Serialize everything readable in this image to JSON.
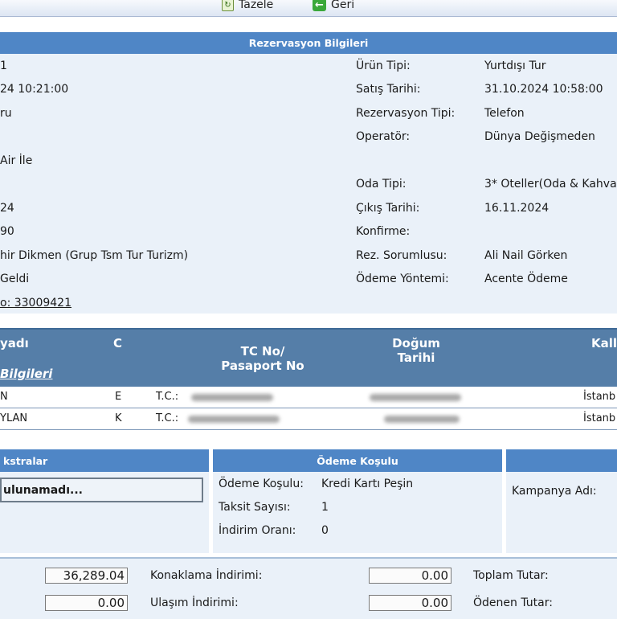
{
  "toolbar": {
    "refresh_label": "Tazele",
    "back_label": "Geri"
  },
  "reservation": {
    "title": "Rezervasyon Bilgileri",
    "left_values": [
      "1",
      "24 10:21:00",
      "ru",
      "",
      " Air İle",
      "",
      "24",
      "90",
      "hir Dikmen (Grup Tsm Tur Turizm)",
      " Geldi",
      "o: 33009421"
    ],
    "fields": [
      {
        "label": "Ürün Tipi:",
        "value": "Yurtdışı Tur"
      },
      {
        "label": "Satış Tarihi:",
        "value": "31.10.2024 10:58:00"
      },
      {
        "label": "Rezervasyon Tipi:",
        "value": "Telefon"
      },
      {
        "label": "Operatör:",
        "value": "Dünya Değişmeden"
      },
      {
        "label": "",
        "value": ""
      },
      {
        "label": "Oda Tipi:",
        "value": "3* Oteller(Oda & Kahva"
      },
      {
        "label": "Çıkış Tarihi:",
        "value": "16.11.2024"
      },
      {
        "label": "Konfirme:",
        "value": ""
      },
      {
        "label": "Rez. Sorumlusu:",
        "value": "Ali Nail Görken"
      },
      {
        "label": "Ödeme Yöntemi:",
        "value": "Acente Ödeme"
      }
    ]
  },
  "passengers": {
    "headers": {
      "surname": "yadı",
      "gender": "C",
      "tc_line1": "TC No/",
      "tc_line2": "Pasaport No",
      "birth_line1": "Doğum",
      "birth_line2": "Tarihi",
      "city": "Kall",
      "info_link": "Bilgileri"
    },
    "rows": [
      {
        "surname": "N",
        "gender": "E",
        "id_type": "T.C.:",
        "city": "İstanb"
      },
      {
        "surname": "YLAN",
        "gender": "K",
        "id_type": "T.C.:",
        "city": "İstanb"
      }
    ]
  },
  "extras": {
    "title": "kstralar",
    "box_text": "ulunamadı..."
  },
  "payment": {
    "title": "Ödeme Koşulu",
    "rows": [
      {
        "label": "Ödeme Koşulu:",
        "value": "Kredi Kartı Peşin"
      },
      {
        "label": "Taksit Sayısı:",
        "value": "1"
      },
      {
        "label": "İndirim Oranı:",
        "value": "0"
      }
    ]
  },
  "campaign": {
    "label": "Kampanya Adı:"
  },
  "totals": {
    "amount1": "36,289.04",
    "amount2": "0.00",
    "konaklama_label": "Konaklama İndirimi:",
    "konaklama_value": "0.00",
    "ulasim_label": "Ulaşım İndirimi:",
    "ulasim_value": "0.00",
    "toplam_label": "Toplam Tutar:",
    "odenen_label": "Ödenen Tutar:"
  },
  "colors": {
    "header_blue": "#4f86c6",
    "table_head": "#557ea8",
    "panel_bg": "#eaf1f9"
  }
}
